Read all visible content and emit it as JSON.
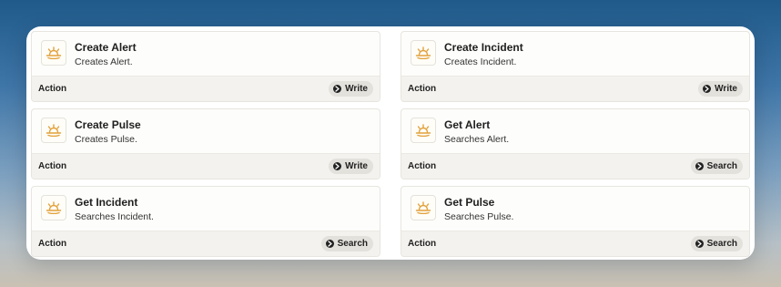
{
  "actions": [
    {
      "title": "Create Alert",
      "description": "Creates Alert.",
      "type": "Action",
      "badge": "Write"
    },
    {
      "title": "Create Incident",
      "description": "Creates Incident.",
      "type": "Action",
      "badge": "Write"
    },
    {
      "title": "Create Pulse",
      "description": "Creates Pulse.",
      "type": "Action",
      "badge": "Write"
    },
    {
      "title": "Get Alert",
      "description": "Searches Alert.",
      "type": "Action",
      "badge": "Search"
    },
    {
      "title": "Get Incident",
      "description": "Searches Incident.",
      "type": "Action",
      "badge": "Search"
    },
    {
      "title": "Get Pulse",
      "description": "Searches Pulse.",
      "type": "Action",
      "badge": "Search"
    }
  ],
  "icons": {
    "app": "sunrise-app-icon",
    "write": "write-arrow-icon",
    "search": "search-arrow-icon"
  },
  "colors": {
    "app_icon": "#e2a23b",
    "pill_bg": "#e3e1dc"
  }
}
